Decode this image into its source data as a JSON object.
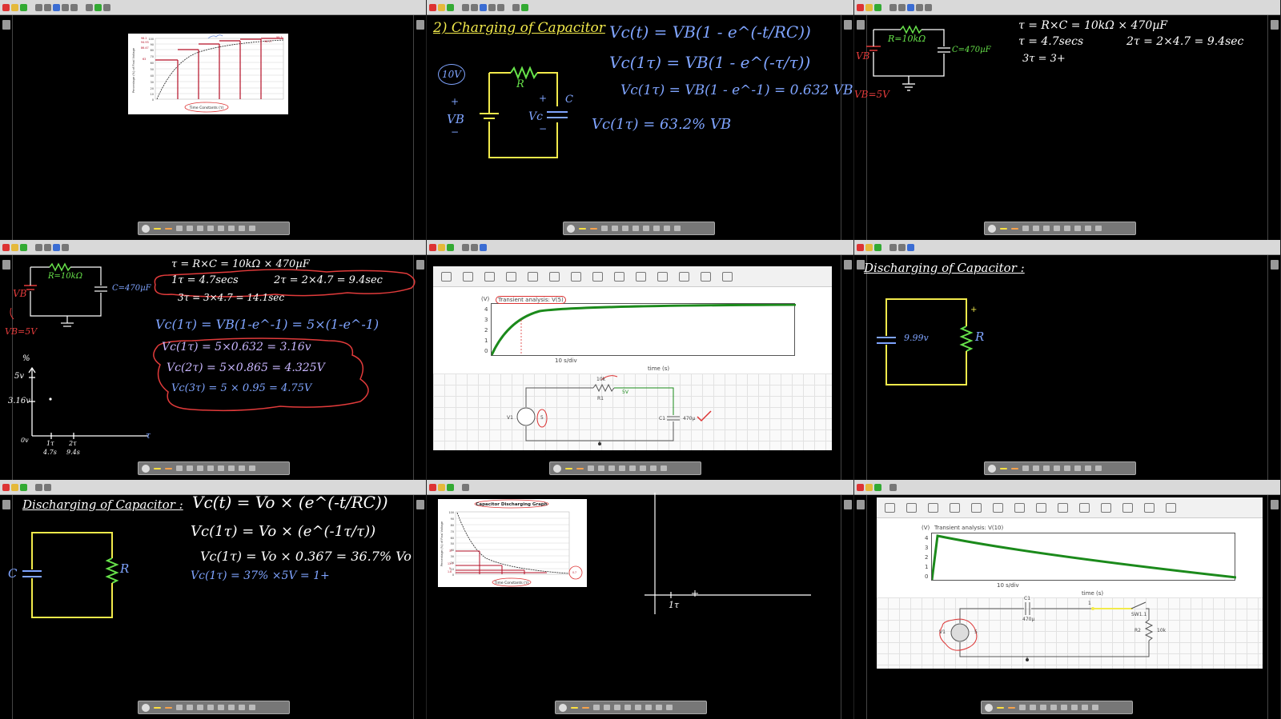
{
  "app": {
    "toolbar_labels": [
      "Pen",
      "Highlighter",
      "Eraser",
      "Pointer",
      "Undo",
      "Redo",
      "Shapes",
      "Pages",
      "Stamps",
      "Grid"
    ]
  },
  "colors": {
    "chalk_white": "#ffffff",
    "chalk_yellow": "#f2ea4b",
    "chalk_green": "#67e24a",
    "chalk_blue": "#7fa4ff",
    "chalk_red": "#e23b3b",
    "chalk_lavender": "#c9b7ff",
    "sim_green": "#1b8a1b"
  },
  "panels": {
    "p1": {
      "chart_title": "Time Constants (τ)",
      "y_axis_label": "Percentage (%) of Final Voltage",
      "y_ticks": [
        "100",
        "90",
        "80",
        "70",
        "60",
        "50",
        "40",
        "30",
        "20",
        "10",
        "0"
      ],
      "left_values": [
        "98.2",
        "94.93",
        "86.47",
        "63"
      ],
      "right_values": [
        "99.3",
        "98.17"
      ]
    },
    "p2": {
      "title": "2) Charging of Capacitor",
      "voltage_label": "10V",
      "resistor_label": "R",
      "capacitor_label": "C",
      "vc_label": "Vc",
      "vb_label": "VB",
      "plus": "+",
      "minus": "−",
      "eq1": "Vc(t) = VB(1 - e^(-t/RC))",
      "eq2": "Vc(1τ) = VB(1 - e^(-τ/τ))",
      "eq3": "Vc(1τ) = VB(1 - e^-1) = 0.632 VB",
      "eq4": "Vc(1τ) = 63.2% VB"
    },
    "p3": {
      "resistor_label": "R=10kΩ",
      "capacitor_label": "C=470µF",
      "vb_label": "VB",
      "vb_value": "VB=5V",
      "eq1": "τ = R×C = 10kΩ × 470µF",
      "eq2": "τ = 4.7secs",
      "eq2b": "2τ = 2×4.7 = 9.4sec",
      "eq3": "3τ = 3+"
    },
    "p4": {
      "resistor_label": "R=10kΩ",
      "capacitor_label": "C=470µF",
      "vb_label": "VB",
      "vb_value": "VB=5V",
      "eq1": "τ = R×C = 10kΩ × 470µF",
      "eq2": "1τ = 4.7secs",
      "eq2b": "2τ = 2×4.7 = 9.4sec",
      "eq3": "3τ = 3×4.7 = 14.1sec",
      "eq4": "Vc(1τ) = VB(1-e^-1) = 5×(1-e^-1)",
      "eq5": "Vc(1τ) = 5×0.632 = 3.16v",
      "eq6": "Vc(2τ) = 5×0.865 = 4.325V",
      "eq7": "Vc(3τ) = 5 × 0.95 = 4.75V",
      "graph_y_top": "5v",
      "graph_y_mid": "3.16v",
      "graph_pct": "%",
      "graph_origin": "0v",
      "graph_tick1": "1τ",
      "graph_tick1_val": "4.7s",
      "graph_tick2": "2τ",
      "graph_tick2_val": "9.4s",
      "graph_x": "τ"
    },
    "p5": {
      "analysis_title": "Transient analysis: V(5)",
      "y_unit": "(V)",
      "y_ticks": [
        "4",
        "3",
        "2",
        "1",
        "0"
      ],
      "x_scale": "10 s/div",
      "x_label": "time (s)",
      "source_label": "V1",
      "source_value": "5",
      "resistor_label": "R1",
      "resistor_value": "10k",
      "node_label": "5V",
      "cap_label": "C1",
      "cap_value": "470µ"
    },
    "p6": {
      "title": "Discharging of Capacitor :",
      "voltage_label": "9.99v",
      "resistor_label": "R",
      "plus": "+"
    },
    "p7": {
      "title": "Discharging of Capacitor :",
      "cap_label": "C",
      "resistor_label": "R",
      "eq1": "Vc(t) = Vo × (e^(-t/RC))",
      "eq2": "Vc(1τ) = Vo × (e^(-1τ/τ))",
      "eq3": "Vc(1τ) = Vo × 0.367 = 36.7% Vo",
      "eq4": "Vc(1τ) = 37% ×5V = 1+"
    },
    "p8": {
      "chart_title": "Capacitor Discharging Graph",
      "x_label": "Time Constants (τ)",
      "y_axis_label": "Percentage (%) of Final Voltage",
      "y_ticks": [
        "100",
        "90",
        "80",
        "70",
        "60",
        "50",
        "40",
        "30",
        "20",
        "10",
        "0"
      ],
      "values": [
        "37",
        "13.7",
        "5",
        "1.8",
        "0.7"
      ],
      "sketch_tick": "1τ"
    },
    "p9": {
      "analysis_title": "Transient analysis: V(10)",
      "y_unit": "(V)",
      "y_ticks": [
        "4",
        "3",
        "2",
        "1",
        "0"
      ],
      "x_scale": "10 s/div",
      "x_label": "time (s)",
      "source_label": "V1",
      "source_value": "5",
      "cap_label": "C1",
      "cap_value": "470µ",
      "resistor_label": "R2",
      "resistor_value": "10k",
      "switch_label": "SW1.1",
      "node_label": "1"
    }
  }
}
